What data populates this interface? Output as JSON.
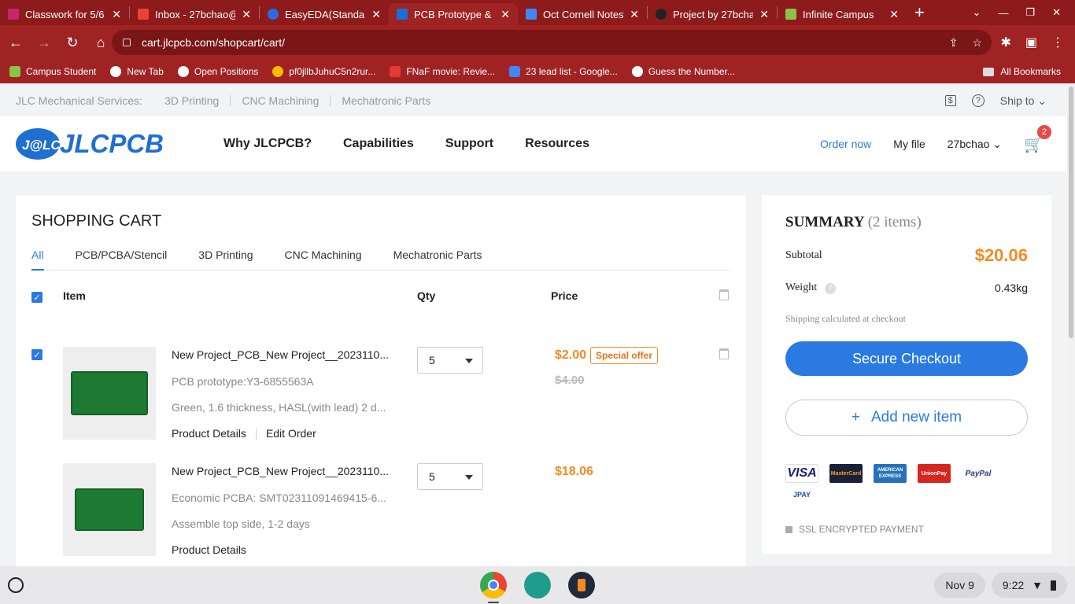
{
  "browser": {
    "tabs": [
      {
        "title": "Classwork for 5/6",
        "color": "#c8256b"
      },
      {
        "title": "Inbox - 27bchao@",
        "color": "#ea4335"
      },
      {
        "title": "EasyEDA(Standard",
        "color": "#2a6ae2"
      },
      {
        "title": "PCB Prototype & I",
        "color": "#1a6fd6"
      },
      {
        "title": "Oct Cornell Notes",
        "color": "#4285f4"
      },
      {
        "title": "Project by 27bcha",
        "color": "#222222"
      },
      {
        "title": "Infinite Campus",
        "color": "#8bc34a"
      }
    ],
    "active_tab": 3,
    "url": "cart.jlcpcb.com/shopcart/cart/",
    "bookmarks": [
      {
        "label": "Campus Student",
        "color": "#8bc34a"
      },
      {
        "label": "New Tab",
        "color": "#ffffff"
      },
      {
        "label": "Open Positions",
        "color": "#ffffff"
      },
      {
        "label": "pf0jllbJuhuC5n2rur...",
        "color": "#fbbc05"
      },
      {
        "label": "FNaF movie: Revie...",
        "color": "#e53935"
      },
      {
        "label": "23 lead list - Google...",
        "color": "#4285f4"
      },
      {
        "label": "Guess the Number...",
        "color": "#ffffff"
      }
    ],
    "all_bookmarks": "All Bookmarks"
  },
  "topbar": {
    "label": "JLC Mechanical Services:",
    "links": [
      "3D Printing",
      "CNC Machining",
      "Mechatronic Parts"
    ],
    "ship_to": "Ship to"
  },
  "header": {
    "logo_text": "JLCPCB",
    "logo_badge": "J@LC",
    "nav": [
      "Why JLCPCB?",
      "Capabilities",
      "Support",
      "Resources"
    ],
    "order_now": "Order now",
    "my_file": "My file",
    "user": "27bchao",
    "cart_count": "2"
  },
  "cart": {
    "title": "SHOPPING CART",
    "tabs": [
      "All",
      "PCB/PCBA/Stencil",
      "3D Printing",
      "CNC Machining",
      "Mechatronic Parts"
    ],
    "columns": {
      "item": "Item",
      "qty": "Qty",
      "price": "Price"
    },
    "items": [
      {
        "name": "New Project_PCB_New Project__2023110...",
        "line1": "PCB prototype:Y3-6855563A",
        "line2": "Green, 1.6 thickness, HASL(with lead) 2 d...",
        "links": [
          "Product Details",
          "Edit Order"
        ],
        "qty": "5",
        "price": "$2.00",
        "offer": "Special offer",
        "old_price": "$4.00"
      },
      {
        "name": "New Project_PCB_New Project__2023110...",
        "line1": "Economic PCBA: SMT02311091469415-6...",
        "line2": "Assemble top side, 1-2 days",
        "links": [
          "Product Details"
        ],
        "qty": "5",
        "price": "$18.06"
      }
    ]
  },
  "summary": {
    "title": "SUMMARY",
    "count": "(2 items)",
    "subtotal_label": "Subtotal",
    "subtotal": "$20.06",
    "weight_label": "Weight",
    "weight": "0.43kg",
    "shipping_note": "Shipping calculated at checkout",
    "checkout": "Secure Checkout",
    "add_item": "Add new item",
    "payments": [
      "VISA",
      "MasterCard",
      "AMERICAN EXPRESS",
      "UnionPay",
      "PayPal",
      "JPAY"
    ],
    "ssl": "SSL ENCRYPTED PAYMENT"
  },
  "shelf": {
    "date": "Nov 9",
    "time": "9:22"
  }
}
